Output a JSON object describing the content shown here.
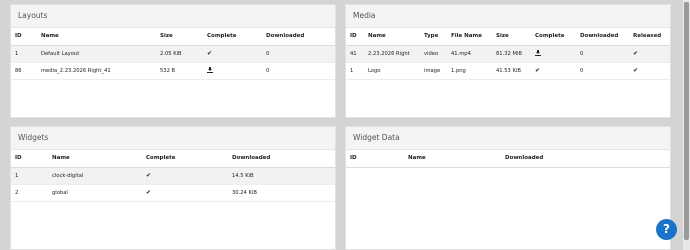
{
  "layouts": {
    "title": "Layouts",
    "headers": [
      "ID",
      "Name",
      "Size",
      "Complete",
      "Downloaded"
    ],
    "rows": [
      {
        "id": "1",
        "name": "Default Layout",
        "size": "2.05 KiB",
        "complete": "check",
        "downloaded": "0"
      },
      {
        "id": "86",
        "name": "media_2.23.2026 Right_41",
        "size": "532 B",
        "complete": "download",
        "downloaded": "0"
      }
    ]
  },
  "media": {
    "title": "Media",
    "headers": [
      "ID",
      "Name",
      "Type",
      "File Name",
      "Size",
      "Complete",
      "Downloaded",
      "Released"
    ],
    "rows": [
      {
        "id": "41",
        "name": "2.23.2026 Right",
        "type": "video",
        "file_name": "41.mp4",
        "size": "81.32 MiB",
        "complete": "download",
        "downloaded": "0",
        "released": "check"
      },
      {
        "id": "1",
        "name": "Logo",
        "type": "image",
        "file_name": "1.png",
        "size": "41.53 KiB",
        "complete": "check",
        "downloaded": "0",
        "released": "check"
      }
    ]
  },
  "widgets": {
    "title": "Widgets",
    "headers": [
      "ID",
      "Name",
      "Complete",
      "Downloaded"
    ],
    "rows": [
      {
        "id": "1",
        "name": "clock-digital",
        "complete": "check",
        "downloaded": "14.5 KiB"
      },
      {
        "id": "2",
        "name": "global",
        "complete": "check",
        "downloaded": "30.24 KiB"
      }
    ]
  },
  "widget_data": {
    "title": "Widget Data",
    "headers": [
      "ID",
      "Name",
      "Downloaded"
    ]
  },
  "help_button": {
    "label": "?"
  },
  "icons": {
    "check": "✔",
    "download": "download-icon"
  },
  "colors": {
    "help_button": "#1a73c9",
    "background": "#d4d4d4"
  }
}
